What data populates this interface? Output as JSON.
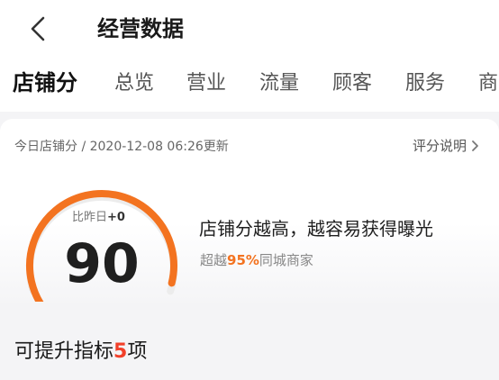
{
  "header": {
    "title": "经营数据"
  },
  "tabs": [
    {
      "label": "店铺分",
      "active": true
    },
    {
      "label": "总览"
    },
    {
      "label": "营业"
    },
    {
      "label": "流量"
    },
    {
      "label": "顾客"
    },
    {
      "label": "服务"
    },
    {
      "label": "商"
    }
  ],
  "score_card": {
    "updated_label": "今日店铺分 / 2020-12-08 06:26更新",
    "explain_label": "评分说明",
    "diff_label": "比昨日",
    "diff_value": "+0",
    "score": "90",
    "score_fraction": 0.9,
    "message": "店铺分越高，越容易获得曝光",
    "exceed_prefix": "超越",
    "exceed_percent": "95%",
    "exceed_suffix": "同城商家"
  },
  "improve": {
    "prefix": "可提升指标",
    "count": "5",
    "suffix": "项"
  },
  "colors": {
    "accent": "#f37320",
    "highlight": "#f2402a",
    "track": "#ececec"
  }
}
